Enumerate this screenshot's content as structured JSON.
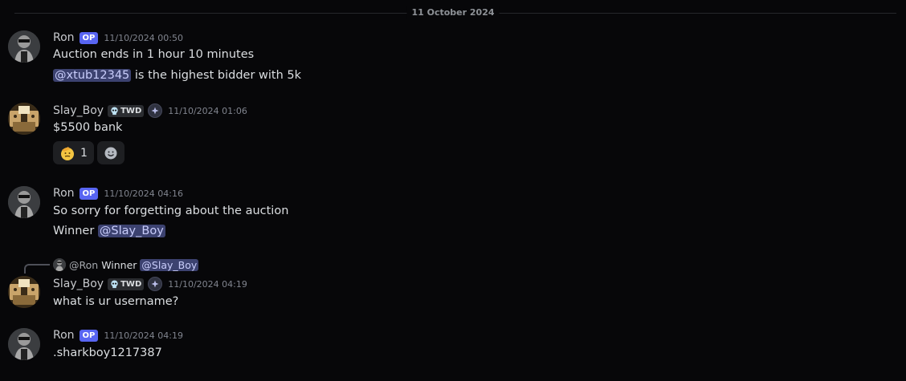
{
  "date_divider": "11 October 2024",
  "users": {
    "ron": {
      "name": "Ron",
      "badge": "OP"
    },
    "slay": {
      "name": "Slay_Boy",
      "tag": "TWD"
    }
  },
  "messages": [
    {
      "author": "Ron",
      "badge": "OP",
      "timestamp": "11/10/2024 00:50",
      "lines": [
        "Auction ends in 1 hour 10 minutes"
      ],
      "mention_line": {
        "mention": "@xtub12345",
        "after": " is the highest bidder with 5k"
      }
    },
    {
      "author": "Slay_Boy",
      "tag": "TWD",
      "timestamp": "11/10/2024 01:06",
      "lines": [
        "$5500 bank"
      ],
      "reactions": [
        {
          "emoji": "saluting-face",
          "count": "1"
        }
      ]
    },
    {
      "author": "Ron",
      "badge": "OP",
      "timestamp": "11/10/2024 04:16",
      "lines": [
        "So sorry for forgetting about the auction"
      ],
      "mention_line": {
        "before": "Winner ",
        "mention": "@Slay_Boy"
      }
    },
    {
      "reply_to": {
        "user": "@Ron",
        "text": "Winner ",
        "mention": "@Slay_Boy"
      },
      "author": "Slay_Boy",
      "tag": "TWD",
      "timestamp": "11/10/2024 04:19",
      "lines": [
        "what is ur username?"
      ]
    },
    {
      "author": "Ron",
      "badge": "OP",
      "timestamp": "11/10/2024 04:19",
      "lines": [
        ".sharkboy1217387"
      ]
    }
  ],
  "colors": {
    "background": "#070709",
    "mention_bg": "#3c4270",
    "op_badge": "#5865f2"
  }
}
